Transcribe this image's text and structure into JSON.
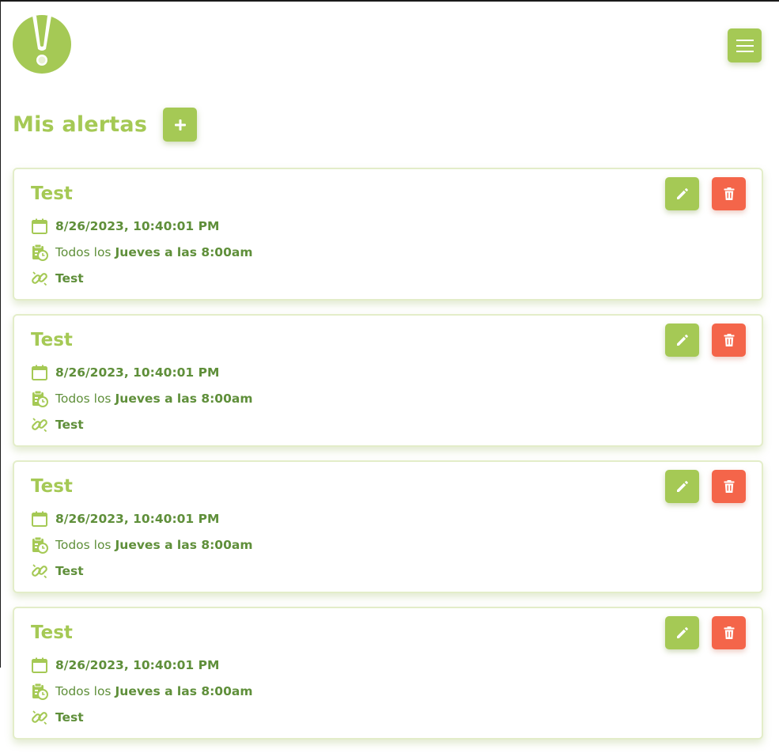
{
  "header": {
    "logo_icon": "alert-leaf-logo",
    "menu_icon": "hamburger-icon"
  },
  "page": {
    "title": "Mis alertas",
    "add_icon": "plus-icon"
  },
  "colors": {
    "accent": "#a5c955",
    "text": "#5f8f3a",
    "danger": "#f4654a",
    "card_border": "#e3edc9"
  },
  "alerts": [
    {
      "title": "Test",
      "datetime": "8/26/2023, 10:40:01 PM",
      "schedule_prefix": "Todos los",
      "schedule": "Jueves a las 8:00am",
      "link": "Test"
    },
    {
      "title": "Test",
      "datetime": "8/26/2023, 10:40:01 PM",
      "schedule_prefix": "Todos los",
      "schedule": "Jueves a las 8:00am",
      "link": "Test"
    },
    {
      "title": "Test",
      "datetime": "8/26/2023, 10:40:01 PM",
      "schedule_prefix": "Todos los",
      "schedule": "Jueves a las 8:00am",
      "link": "Test"
    },
    {
      "title": "Test",
      "datetime": "8/26/2023, 10:40:01 PM",
      "schedule_prefix": "Todos los",
      "schedule": "Jueves a las 8:00am",
      "link": "Test"
    }
  ]
}
